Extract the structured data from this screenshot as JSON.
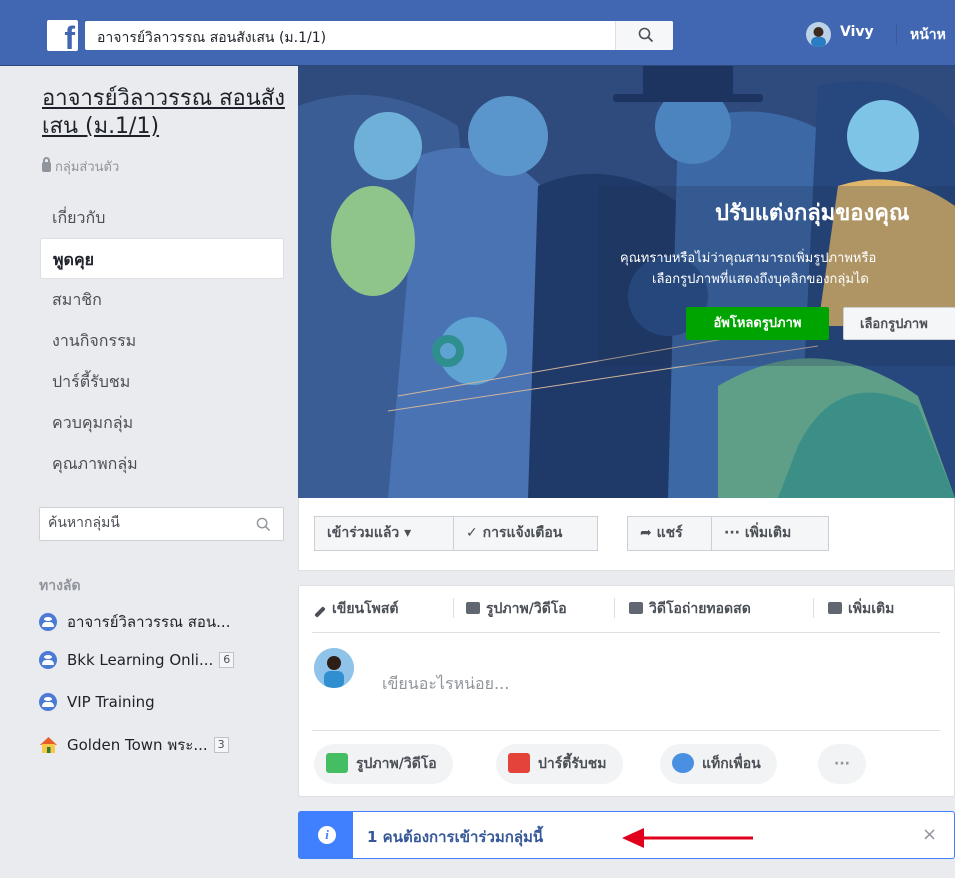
{
  "topbar": {
    "logo": "f",
    "search_value": "อาจารย์วิลาวรรณ สอนสังเสน (ม.1/1)",
    "user_name": "Vivy",
    "home_label": "หน้าห"
  },
  "group": {
    "title": "อาจารย์วิลาวรรณ สอนสังเสน (ม.1/1)",
    "privacy": "กลุ่มส่วนตัว"
  },
  "nav": [
    {
      "label": "เกี่ยวกับ"
    },
    {
      "label": "พูดคุย"
    },
    {
      "label": "สมาชิก"
    },
    {
      "label": "งานกิจกรรม"
    },
    {
      "label": "ปาร์ตี้รับชม"
    },
    {
      "label": "ควบคุมกลุ่ม"
    },
    {
      "label": "คุณภาพกลุ่ม"
    }
  ],
  "group_search": {
    "placeholder": "ค้นหากลุ่มนี้"
  },
  "shortcuts": {
    "heading": "ทางลัด",
    "items": [
      {
        "label": "อาจารย์วิลาวรรณ สอน...",
        "badge": ""
      },
      {
        "label": "Bkk Learning Onli...",
        "badge": "6"
      },
      {
        "label": "VIP Training",
        "badge": ""
      },
      {
        "label": "Golden Town พระ...",
        "badge": "3"
      }
    ]
  },
  "cover": {
    "title": "ปรับแต่งกลุ่มของคุณ",
    "line1": "คุณทราบหรือไม่ว่าคุณสามารถเพิ่มรูปภาพหรือ",
    "line2": "เลือกรูปภาพที่แสดงถึงบุคลิกของกลุ่มได",
    "upload_button": "อัพโหลดรูปภาพ",
    "choose_button": "เลือกรูปภาพ"
  },
  "actions": {
    "joined": "เข้าร่วมแล้ว ▾",
    "notifications": "✓ การแจ้งเตือน",
    "share": "➦ แชร์",
    "more": "··· เพิ่มเติม"
  },
  "composer": {
    "tabs": [
      "เขียนโพสต์",
      "รูปภาพ/วิดีโอ",
      "วิดีโอถ่ายทอดสด",
      "เพิ่มเติม"
    ],
    "placeholder": "เขียนอะไรหน่อย...",
    "pills": [
      "รูปภาพ/วิดีโอ",
      "ปาร์ตี้รับชม",
      "แท็กเพื่อน",
      "···"
    ]
  },
  "notice": {
    "icon": "i",
    "text": "1 คนต้องการเข้าร่วมกลุ่มนี้",
    "close": "×"
  },
  "colors": {
    "brand": "#4267b2",
    "upload_green": "#00a400",
    "notice_blue": "#4080ff",
    "arrow_red": "#e0001b"
  }
}
